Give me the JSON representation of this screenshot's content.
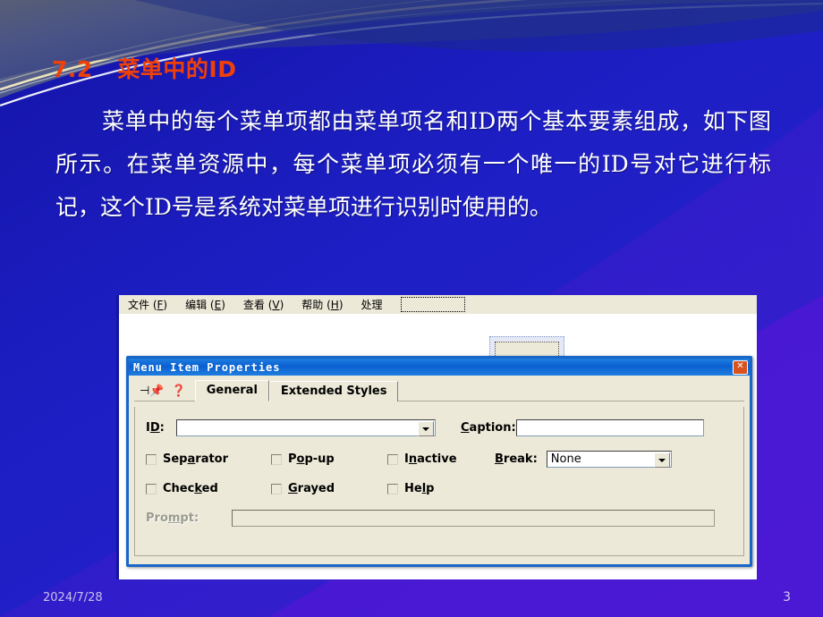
{
  "slide": {
    "title": "7.2   菜单中的ID",
    "body": "菜单中的每个菜单项都由菜单项名和ID两个基本要素组成，如下图所示。在菜单资源中，每个菜单项必须有一个唯一的ID号对它进行标记，这个ID号是系统对菜单项进行识别时使用的。",
    "date": "2024/7/28",
    "page_number": "3",
    "title_color": "#ef4008",
    "background_color_start": "#13148f",
    "background_color_end": "#6a0fd6"
  },
  "screenshot": {
    "menubar": [
      {
        "label": "文件",
        "accel": "F"
      },
      {
        "label": "编辑",
        "accel": "E"
      },
      {
        "label": "查看",
        "accel": "V"
      },
      {
        "label": "帮助",
        "accel": "H"
      },
      {
        "label": "处理",
        "accel": ""
      }
    ],
    "dialog": {
      "title": "Menu Item Properties",
      "close_label": "✕",
      "pin_icon": "pushpin-icon",
      "help_icon": "question-mark-icon",
      "tabs": [
        {
          "label": "General",
          "active": true
        },
        {
          "label": "Extended Styles",
          "active": false
        }
      ],
      "fields": {
        "id_label_pre": "I",
        "id_label_accel": "D",
        "id_label_post": ":",
        "id_value": "",
        "caption_label_accel": "C",
        "caption_label_post": "aption:",
        "caption_value": "",
        "break_label_accel": "B",
        "break_label_post": "reak:",
        "break_value": "None",
        "prompt_label_pre": "Pro",
        "prompt_label_accel": "m",
        "prompt_label_post": "pt:",
        "prompt_value": ""
      },
      "checkboxes": [
        {
          "pre": "Sep",
          "accel": "a",
          "post": "rator",
          "checked": false
        },
        {
          "pre": "P",
          "accel": "o",
          "post": "p-up",
          "checked": false
        },
        {
          "pre": "I",
          "accel": "n",
          "post": "active",
          "checked": false
        },
        {
          "pre": "Chec",
          "accel": "k",
          "post": "ed",
          "checked": false
        },
        {
          "pre": "",
          "accel": "G",
          "post": "rayed",
          "checked": false
        },
        {
          "pre": "He",
          "accel": "l",
          "post": "p",
          "checked": false
        }
      ]
    }
  }
}
